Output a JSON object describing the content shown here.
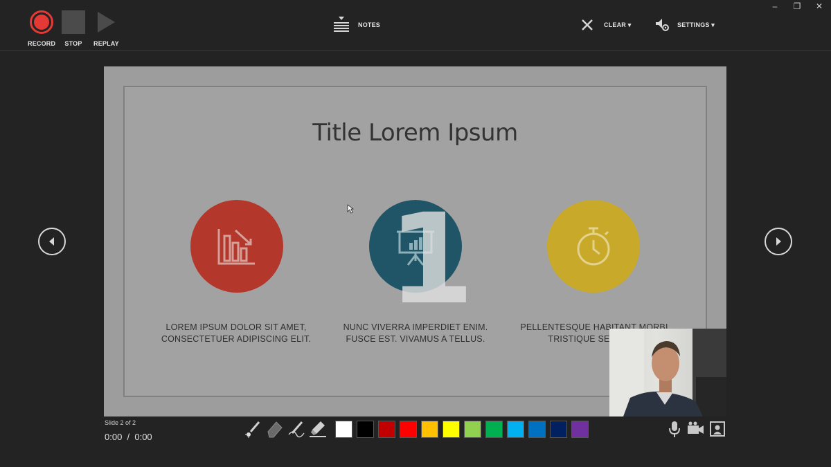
{
  "toolbar": {
    "record_label": "RECORD",
    "stop_label": "STOP",
    "replay_label": "REPLAY",
    "notes_label": "NOTES",
    "clear_label": "CLEAR ▾",
    "settings_label": "SETTINGS ▾"
  },
  "window_controls": {
    "minimize": "–",
    "restore": "❐",
    "close": "✕"
  },
  "slide": {
    "title": "Title Lorem Ipsum",
    "overlay_number": "1",
    "items": [
      {
        "caption_line1": "LOREM IPSUM DOLOR SIT AMET,",
        "caption_line2": "CONSECTETUER ADIPISCING ELIT.",
        "icon": "bar-chart-down-icon",
        "color": "#b3372a"
      },
      {
        "caption_line1": "NUNC VIVERRA IMPERDIET ENIM.",
        "caption_line2": "FUSCE EST. VIVAMUS A TELLUS.",
        "icon": "presentation-board-icon",
        "color": "#1f5566"
      },
      {
        "caption_line1": "PELLENTESQUE HABITANT MORBI",
        "caption_line2": "TRISTIQUE SENECTU",
        "icon": "stopwatch-icon",
        "color": "#c9a92a"
      }
    ]
  },
  "status": {
    "slide_counter": "Slide 2 of 2",
    "time": "0:00  /  0:00"
  },
  "pen_colors": [
    "#ffffff",
    "#000000",
    "#c00000",
    "#ff0000",
    "#ffc000",
    "#ffff00",
    "#92d050",
    "#00b050",
    "#00b0f0",
    "#0070c0",
    "#002060",
    "#7030a0"
  ]
}
